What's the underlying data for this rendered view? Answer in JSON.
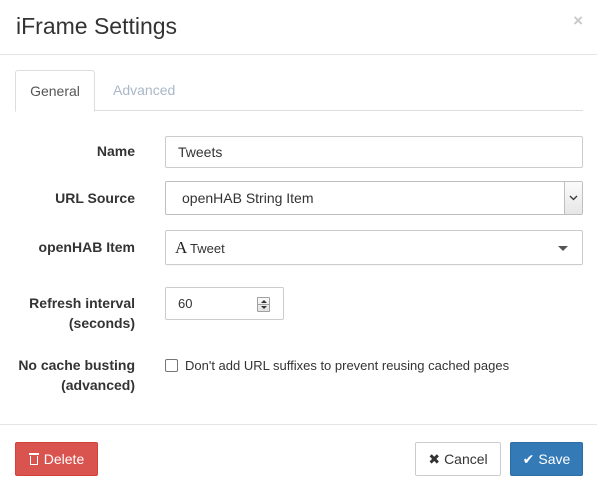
{
  "header": {
    "title": "iFrame Settings",
    "close_glyph": "×"
  },
  "tabs": [
    {
      "label": "General",
      "active": true
    },
    {
      "label": "Advanced",
      "active": false
    }
  ],
  "form": {
    "name": {
      "label": "Name",
      "value": "Tweets"
    },
    "url_source": {
      "label": "URL Source",
      "value": "openHAB String Item"
    },
    "openhab_item": {
      "label": "openHAB Item",
      "type_icon": "A",
      "value": "Tweet"
    },
    "refresh_interval": {
      "label_line1": "Refresh interval",
      "label_line2": "(seconds)",
      "value": "60"
    },
    "no_cache_busting": {
      "label_line1": "No cache busting",
      "label_line2": "(advanced)",
      "checkbox_label": "Don't add URL suffixes to prevent reusing cached pages",
      "checked": false
    }
  },
  "footer": {
    "delete_label": "Delete",
    "cancel_icon": "✖",
    "cancel_label": "Cancel",
    "save_icon": "✔",
    "save_label": "Save"
  },
  "colors": {
    "delete": "#d9534f",
    "save": "#337ab7",
    "inactive_tab": "#a9b7c6"
  }
}
